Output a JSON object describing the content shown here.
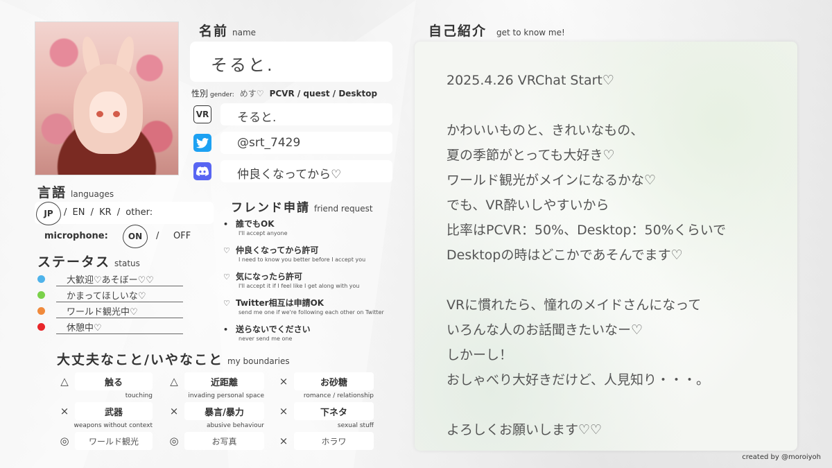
{
  "name_section": {
    "title": "名前",
    "sub": "name",
    "value": "そると."
  },
  "gender": {
    "label": "性別",
    "label_en": "gender:",
    "value": "めす♡",
    "platform": "PCVR / quest / Desktop"
  },
  "sns": [
    {
      "icon": "vrchat-icon",
      "icon_text": "VR",
      "value": "そると."
    },
    {
      "icon": "twitter-icon",
      "icon_text": "",
      "value": "@srt_7429"
    },
    {
      "icon": "discord-icon",
      "icon_text": "",
      "value": "仲良くなってから♡"
    }
  ],
  "languages": {
    "title": "言語",
    "sub": "languages",
    "jp": "JP",
    "rest": "/  EN  /  KR  /  other:",
    "mic_label": "microphone:",
    "mic_on": "ON",
    "mic_sep": "/",
    "mic_off": "OFF"
  },
  "status": {
    "title": "ステータス",
    "sub": "status",
    "items": [
      {
        "color": "#4fb3ea",
        "text": "大歓迎♡あそぼー♡♡"
      },
      {
        "color": "#7ad14a",
        "text": "かまってほしいな♡"
      },
      {
        "color": "#f08a3c",
        "text": "ワールド観光中♡"
      },
      {
        "color": "#e8262a",
        "text": "休憩中♡"
      }
    ]
  },
  "friend_request": {
    "title": "フレンド申請",
    "sub": "friend request",
    "items": [
      {
        "mark": "•",
        "title": "誰でもOK",
        "sub": "I'll accept anyone"
      },
      {
        "mark": "♡",
        "title": "仲良くなってから許可",
        "sub": "I need to know you better before I accept you"
      },
      {
        "mark": "♡",
        "title": "気になったら許可",
        "sub": "I'll accept it if I feel like I get along with you"
      },
      {
        "mark": "♡",
        "title": "Twitter相互は申請OK",
        "sub": "send me one if we're following each other on Twitter"
      },
      {
        "mark": "•",
        "title": "送らないでください",
        "sub": "never send me one"
      }
    ]
  },
  "boundaries": {
    "title": "大丈夫なこと/いやなこと",
    "sub": "my boundaries",
    "items": [
      {
        "mark": "△",
        "label": "触る",
        "sub": "touching"
      },
      {
        "mark": "△",
        "label": "近距離",
        "sub": "invading personal space"
      },
      {
        "mark": "×",
        "label": "お砂糖",
        "sub": "romance / relationship"
      },
      {
        "mark": "×",
        "label": "武器",
        "sub": "weapons without context"
      },
      {
        "mark": "×",
        "label": "暴言/暴力",
        "sub": "abusive behaviour"
      },
      {
        "mark": "×",
        "label": "下ネタ",
        "sub": "sexual stuff"
      },
      {
        "mark": "◎",
        "label": "ワールド観光",
        "sub": ""
      },
      {
        "mark": "◎",
        "label": "お写真",
        "sub": ""
      },
      {
        "mark": "×",
        "label": "ホラワ",
        "sub": ""
      }
    ]
  },
  "intro": {
    "title": "自己紹介",
    "sub": "get to know me!",
    "lines": [
      "2025.4.26 VRChat Start♡",
      "",
      "かわいいものと、きれいなもの、",
      "夏の季節がとっても大好き♡",
      "ワールド観光がメインになるかな♡",
      "でも、VR酔いしやすいから",
      "比率はPCVR：50%、Desktop：50%くらいで",
      "Desktopの時はどこかであそんでます♡",
      "",
      "VRに慣れたら、憧れのメイドさんになって",
      "いろんな人のお話聞きたいなー♡",
      "しかーし！",
      "おしゃべり大好きだけど、人見知り・・・。",
      "",
      "よろしくお願いします♡♡"
    ]
  },
  "credit": "created by @moroiyoh",
  "colors": {
    "twitter": "#1da1f2",
    "discord": "#5865f2"
  }
}
